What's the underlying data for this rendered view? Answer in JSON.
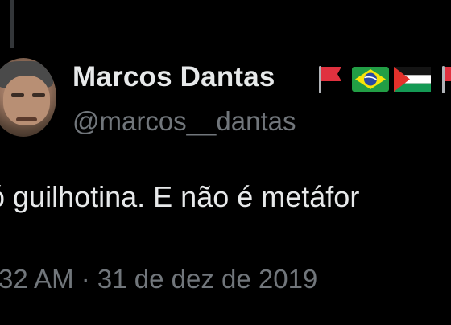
{
  "tweet": {
    "author": {
      "display_name": "Marcos Dantas",
      "handle": "@marcos__dantas",
      "name_emojis": [
        "red-flag-icon",
        "brazil-flag-icon",
        "palestine-flag-icon",
        "red-flag-icon"
      ]
    },
    "text": "ó guilhotina. E não é metáfor",
    "timestamp": "32 AM · 31 de dez de 2019"
  },
  "colors": {
    "background": "#000000",
    "primary_text": "#e7e9ea",
    "secondary_text": "#71767b",
    "thread_line": "#333639"
  }
}
